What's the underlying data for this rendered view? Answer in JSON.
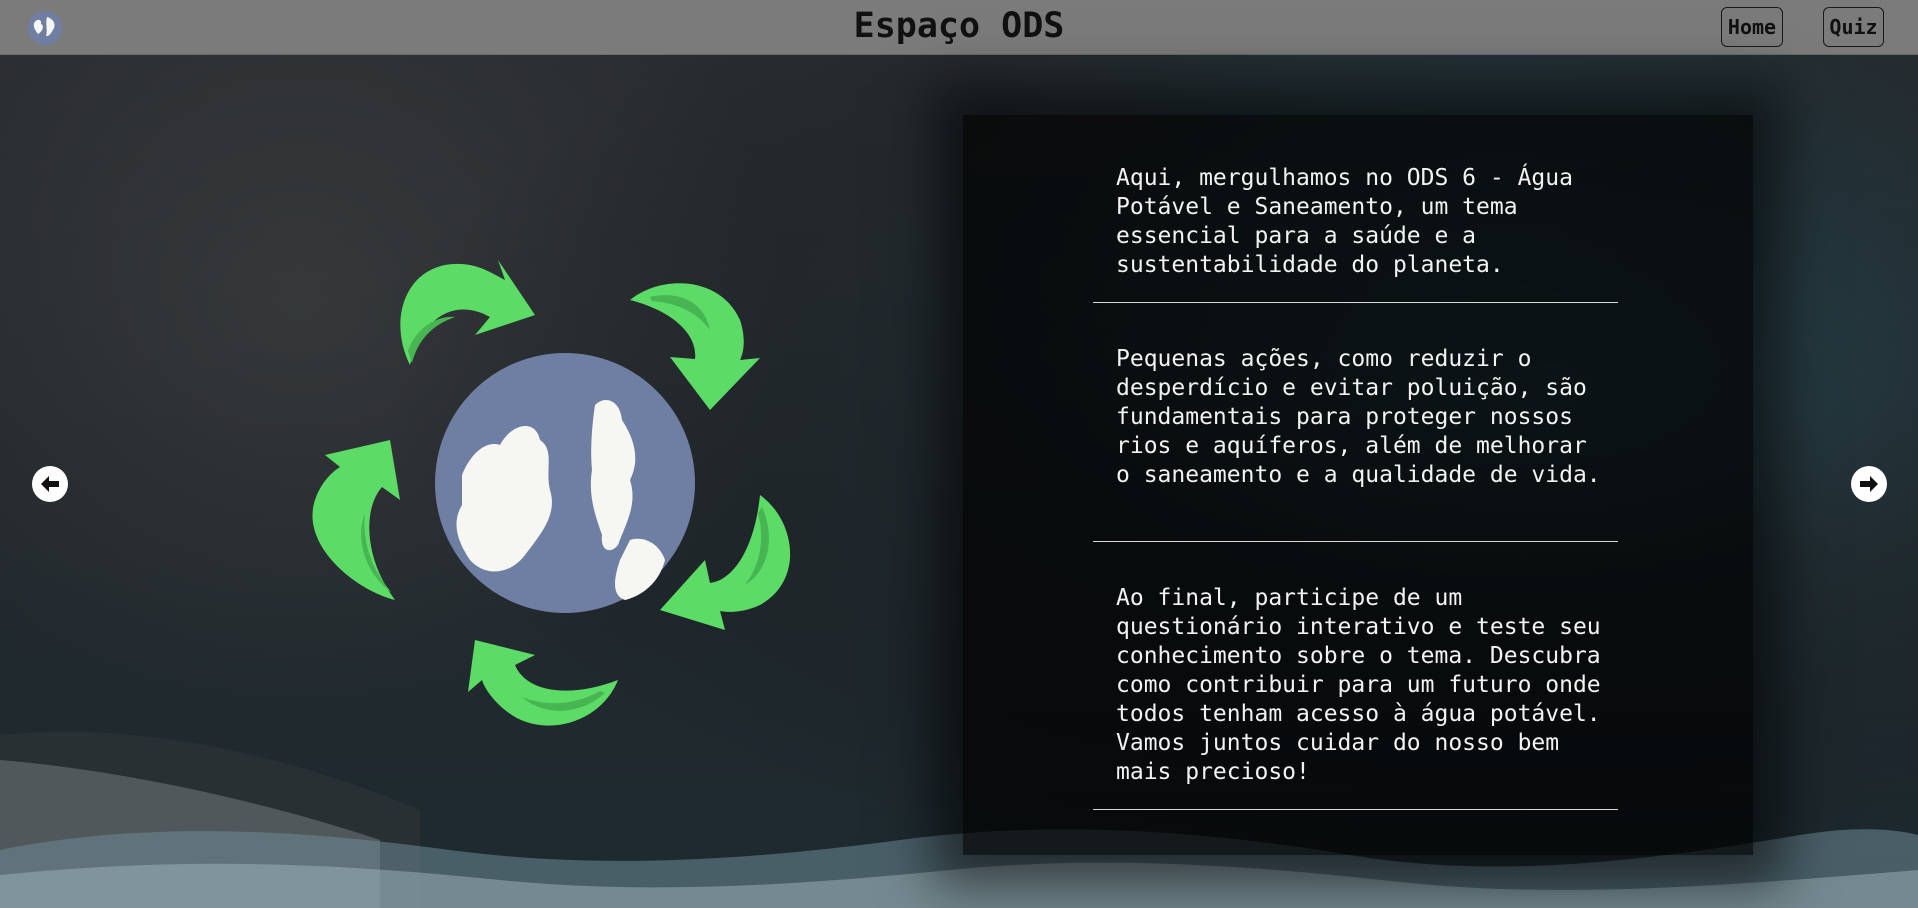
{
  "header": {
    "logo_icon": "globe-icon",
    "title": "Espaço ODS",
    "nav": [
      {
        "label": "Home"
      },
      {
        "label": "Quiz"
      }
    ]
  },
  "carousel": {
    "prev_icon": "arrow-left-icon",
    "next_icon": "arrow-right-icon"
  },
  "illustration": {
    "icon": "recycling-globe-icon",
    "arrow_color": "#5cdb67",
    "globe_color": "#6e7fa3",
    "land_color": "#f6f6f2"
  },
  "content": {
    "paragraphs": [
      "Aqui, mergulhamos no ODS 6 - Água Potável e Saneamento, um tema essencial para a saúde e a sustentabilidade do planeta.",
      "Pequenas ações, como reduzir o desperdício e evitar poluição, são fundamentais para proteger nossos rios e aquíferos, além de melhorar o saneamento e a qualidade de vida.",
      "Ao final, participe de um questionário interativo e teste seu conhecimento sobre o tema. Descubra como contribuir para um futuro onde todos tenham acesso à água potável. Vamos juntos cuidar do nosso bem mais precioso!"
    ]
  },
  "colors": {
    "header_bg": "#7b7b7b",
    "panel_bg": "#000000",
    "text": "#f2f2f2"
  }
}
